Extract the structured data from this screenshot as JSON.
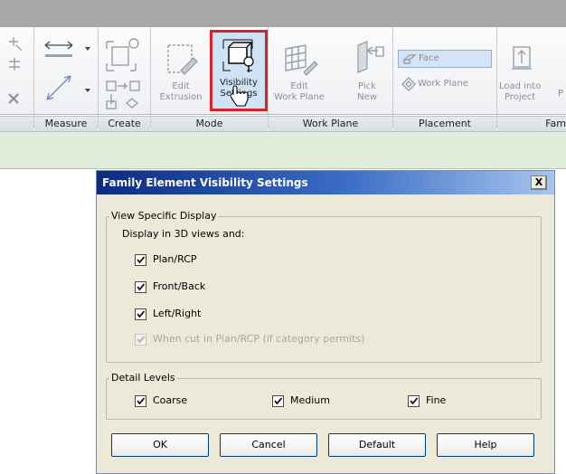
{
  "ribbon": {
    "groups": [
      {
        "label": "Measure"
      },
      {
        "label": "Create"
      },
      {
        "label": "Mode"
      },
      {
        "label": "Work Plane"
      },
      {
        "label": "Placement"
      },
      {
        "label": "Fam"
      }
    ],
    "buttons": {
      "edit_extrusion": [
        "Edit",
        "Extrusion"
      ],
      "visibility_settings": [
        "Visibility",
        "Settings"
      ],
      "edit_work_plane": [
        "Edit",
        "Work Plane"
      ],
      "pick_new": [
        "Pick",
        "New"
      ],
      "face": "Face",
      "work_plane": "Work Plane",
      "load_into_project": [
        "Load into",
        "Project"
      ],
      "cut_p": "P"
    },
    "highlight_color": "#d9222a"
  },
  "dialog": {
    "title": "Family Element Visibility Settings",
    "close_label": "X",
    "view_specific": {
      "legend": "View Specific Display",
      "subtitle": "Display in 3D views and:",
      "options": [
        {
          "label": "Plan/RCP",
          "checked": true,
          "enabled": true
        },
        {
          "label": "Front/Back",
          "checked": true,
          "enabled": true
        },
        {
          "label": "Left/Right",
          "checked": true,
          "enabled": true
        },
        {
          "label": "When cut in Plan/RCP (if category permits)",
          "checked": true,
          "enabled": false
        }
      ]
    },
    "detail_levels": {
      "legend": "Detail Levels",
      "options": [
        {
          "label": "Coarse",
          "checked": true
        },
        {
          "label": "Medium",
          "checked": true
        },
        {
          "label": "Fine",
          "checked": true
        }
      ]
    },
    "buttons": {
      "ok": "OK",
      "cancel": "Cancel",
      "default": "Default",
      "help": "Help"
    }
  }
}
